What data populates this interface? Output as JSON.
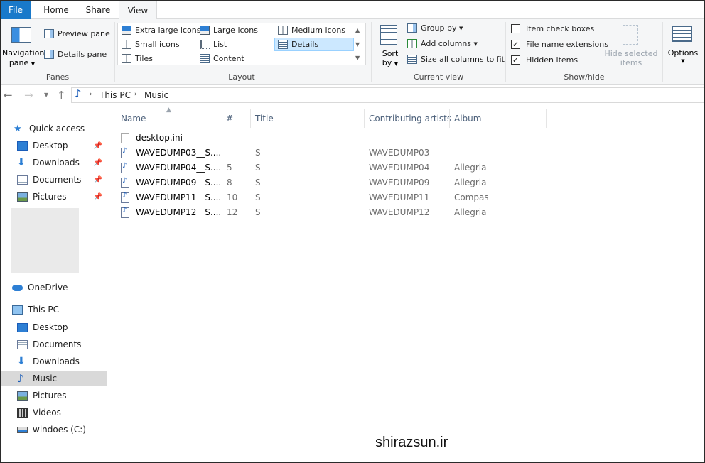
{
  "tabs": {
    "file": "File",
    "home": "Home",
    "share": "Share",
    "view": "View"
  },
  "ribbon": {
    "panes": {
      "navigation_pane_line1": "Navigation",
      "navigation_pane_line2": "pane",
      "preview_pane": "Preview pane",
      "details_pane": "Details pane",
      "label": "Panes"
    },
    "layout": {
      "extra_large_icons": "Extra large icons",
      "large_icons": "Large icons",
      "medium_icons": "Medium icons",
      "small_icons": "Small icons",
      "list": "List",
      "details": "Details",
      "tiles": "Tiles",
      "content": "Content",
      "label": "Layout"
    },
    "current_view": {
      "sort_by_line1": "Sort",
      "sort_by_line2": "by",
      "group_by": "Group by",
      "add_columns": "Add columns",
      "size_all_columns": "Size all columns to fit",
      "label": "Current view"
    },
    "show_hide": {
      "item_check_boxes": "Item check boxes",
      "file_name_extensions": "File name extensions",
      "hidden_items": "Hidden items",
      "hide_selected_line1": "Hide selected",
      "hide_selected_line2": "items",
      "label": "Show/hide",
      "item_check_boxes_checked": false,
      "file_name_extensions_checked": true,
      "hidden_items_checked": true
    },
    "options": {
      "label": "Options"
    }
  },
  "address": {
    "crumbs": [
      "This PC",
      "Music"
    ]
  },
  "sidebar": {
    "quick_access": "Quick access",
    "quick_items": [
      "Desktop",
      "Downloads",
      "Documents",
      "Pictures"
    ],
    "onedrive": "OneDrive",
    "this_pc": "This PC",
    "pc_items": [
      "Desktop",
      "Documents",
      "Downloads",
      "Music",
      "Pictures",
      "Videos",
      "windoes (C:)"
    ]
  },
  "columns": {
    "name": "Name",
    "number": "#",
    "title": "Title",
    "artists": "Contributing artists",
    "album": "Album"
  },
  "files": [
    {
      "name": "desktop.ini",
      "number": "",
      "title": "",
      "artist": "",
      "album": ""
    },
    {
      "name": "WAVEDUMP03__S....",
      "number": "",
      "title": "S",
      "artist": "WAVEDUMP03",
      "album": ""
    },
    {
      "name": "WAVEDUMP04__S....",
      "number": "5",
      "title": "S",
      "artist": "WAVEDUMP04",
      "album": "Allegria"
    },
    {
      "name": "WAVEDUMP09__S....",
      "number": "8",
      "title": "S",
      "artist": "WAVEDUMP09",
      "album": "Allegria"
    },
    {
      "name": "WAVEDUMP11__S....",
      "number": "10",
      "title": "S",
      "artist": "WAVEDUMP11",
      "album": "Compas"
    },
    {
      "name": "WAVEDUMP12__S....",
      "number": "12",
      "title": "S",
      "artist": "WAVEDUMP12",
      "album": "Allegria"
    }
  ],
  "watermark": "shirazsun.ir"
}
